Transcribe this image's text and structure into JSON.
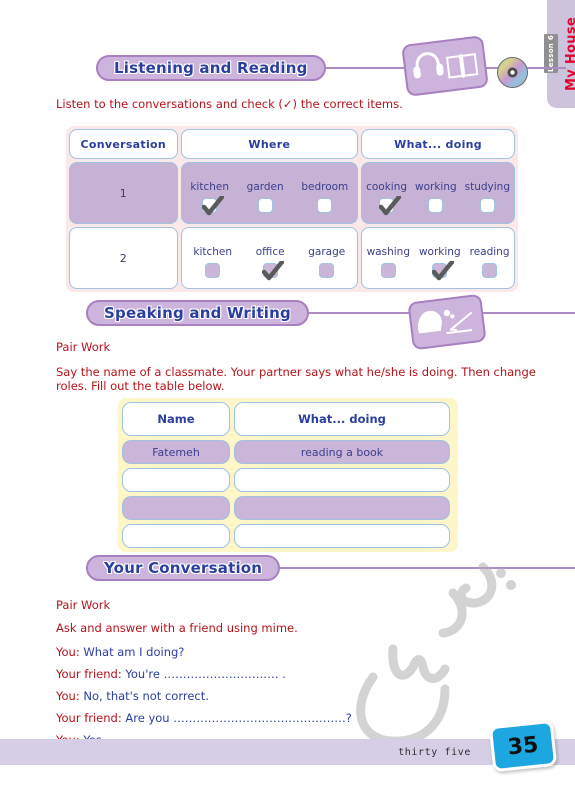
{
  "lesson_tab": {
    "lesson_label": "Lesson 6",
    "lesson_name": "My House"
  },
  "sections": {
    "listening": {
      "title": "Listening and Reading",
      "instruction": "Listen to the conversations and check (✓) the correct items.",
      "icon_card": "headphones-book-icon",
      "disc_icon": "cd-disc-icon"
    },
    "speaking": {
      "title": "Speaking and Writing",
      "pair_work": "Pair Work",
      "instruction_line1": "Say the name of a classmate. Your partner says what he/she is doing. Then change",
      "instruction_line2": "roles. Fill out the table below.",
      "icon_card": "speaking-writing-icon"
    },
    "conversation": {
      "title": "Your Conversation",
      "pair_work": "Pair Work",
      "instruction": "Ask and answer with a friend using mime.",
      "lines": [
        {
          "who": "You:",
          "said": "What am I doing?"
        },
        {
          "who": "Your friend:",
          "said": "You're ………………………… ."
        },
        {
          "who": "You:",
          "said": "No, that's not correct."
        },
        {
          "who": "Your friend:",
          "said": "Are you ………………………………………?"
        },
        {
          "who": "You:",
          "said": "Yes."
        }
      ]
    }
  },
  "table1": {
    "headers": [
      "Conversation",
      "Where",
      "What... doing"
    ],
    "rows": [
      {
        "number": "1",
        "highlighted": true,
        "where": [
          {
            "label": "kitchen",
            "checked": true
          },
          {
            "label": "garden",
            "checked": false
          },
          {
            "label": "bedroom",
            "checked": false
          }
        ],
        "doing": [
          {
            "label": "cooking",
            "checked": true
          },
          {
            "label": "working",
            "checked": false
          },
          {
            "label": "studying",
            "checked": false
          }
        ]
      },
      {
        "number": "2",
        "highlighted": false,
        "where": [
          {
            "label": "kitchen",
            "checked": false
          },
          {
            "label": "office",
            "checked": true
          },
          {
            "label": "garage",
            "checked": false
          }
        ],
        "doing": [
          {
            "label": "washing",
            "checked": false
          },
          {
            "label": "working",
            "checked": true
          },
          {
            "label": "reading",
            "checked": false
          }
        ]
      }
    ]
  },
  "table2": {
    "headers": [
      "Name",
      "What... doing"
    ],
    "rows": [
      {
        "name": "Fatemeh",
        "doing": "reading a book",
        "filled": true
      },
      {
        "name": "",
        "doing": "",
        "filled": false
      },
      {
        "name": "",
        "doing": "",
        "filled": true
      },
      {
        "name": "",
        "doing": "",
        "filled": false
      }
    ]
  },
  "footer": {
    "page_word": "thirty five",
    "page_number": "35",
    "watermark": "persian-script-watermark"
  },
  "colors": {
    "pill_fill": "#cdb4dd",
    "pill_border": "#a87fc0",
    "title_blue": "#2b3f9e",
    "red_text": "#b5121b",
    "table1_frame": "#fbe8e8",
    "table2_frame": "#fcf6c8",
    "row_lilac": "#c6b2d4",
    "cell_border": "#9fc3e0",
    "badge_blue": "#1ca7e0",
    "tab_bg": "#cdc3dd",
    "lesson_red": "#e4032e"
  }
}
